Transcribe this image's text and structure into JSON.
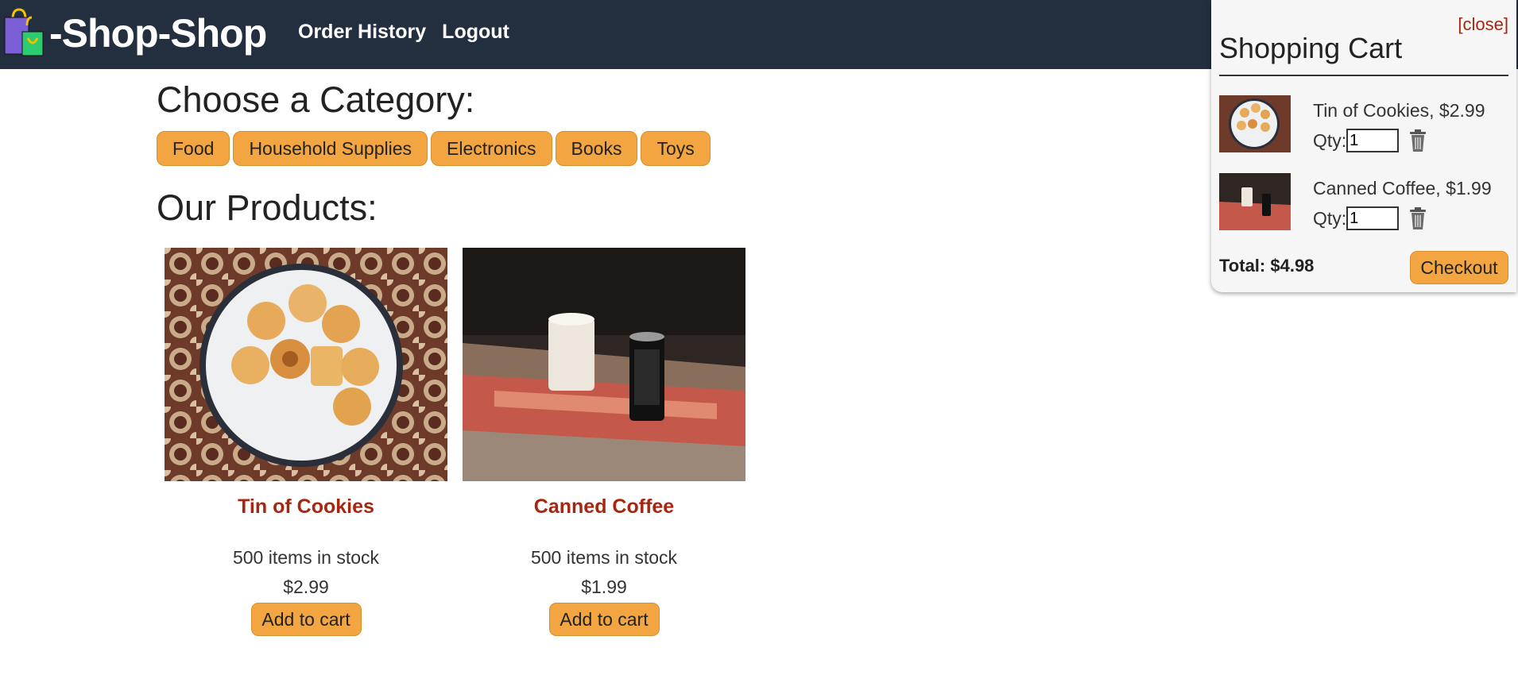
{
  "navbar": {
    "brand": "-Shop-Shop",
    "links": [
      "Order History",
      "Logout"
    ]
  },
  "categories": {
    "heading": "Choose a Category:",
    "items": [
      "Food",
      "Household Supplies",
      "Electronics",
      "Books",
      "Toys"
    ]
  },
  "products": {
    "heading": "Our Products:",
    "items": [
      {
        "name": "Tin of Cookies",
        "stock": "500 items in stock",
        "price": "$2.99",
        "button": "Add to cart"
      },
      {
        "name": "Canned Coffee",
        "stock": "500 items in stock",
        "price": "$1.99",
        "button": "Add to cart"
      }
    ]
  },
  "cart": {
    "close_label": "[close]",
    "title": "Shopping Cart",
    "qty_label": "Qty:",
    "items": [
      {
        "description": "Tin of Cookies, $2.99",
        "qty": "1"
      },
      {
        "description": "Canned Coffee, $1.99",
        "qty": "1"
      }
    ],
    "total": "Total: $4.98",
    "checkout_label": "Checkout"
  },
  "colors": {
    "navbar": "#232e3e",
    "accent_orange": "#f2a541",
    "link_red": "#a6260f"
  },
  "icons": [
    "shopping-bags-icon",
    "trash-icon"
  ]
}
